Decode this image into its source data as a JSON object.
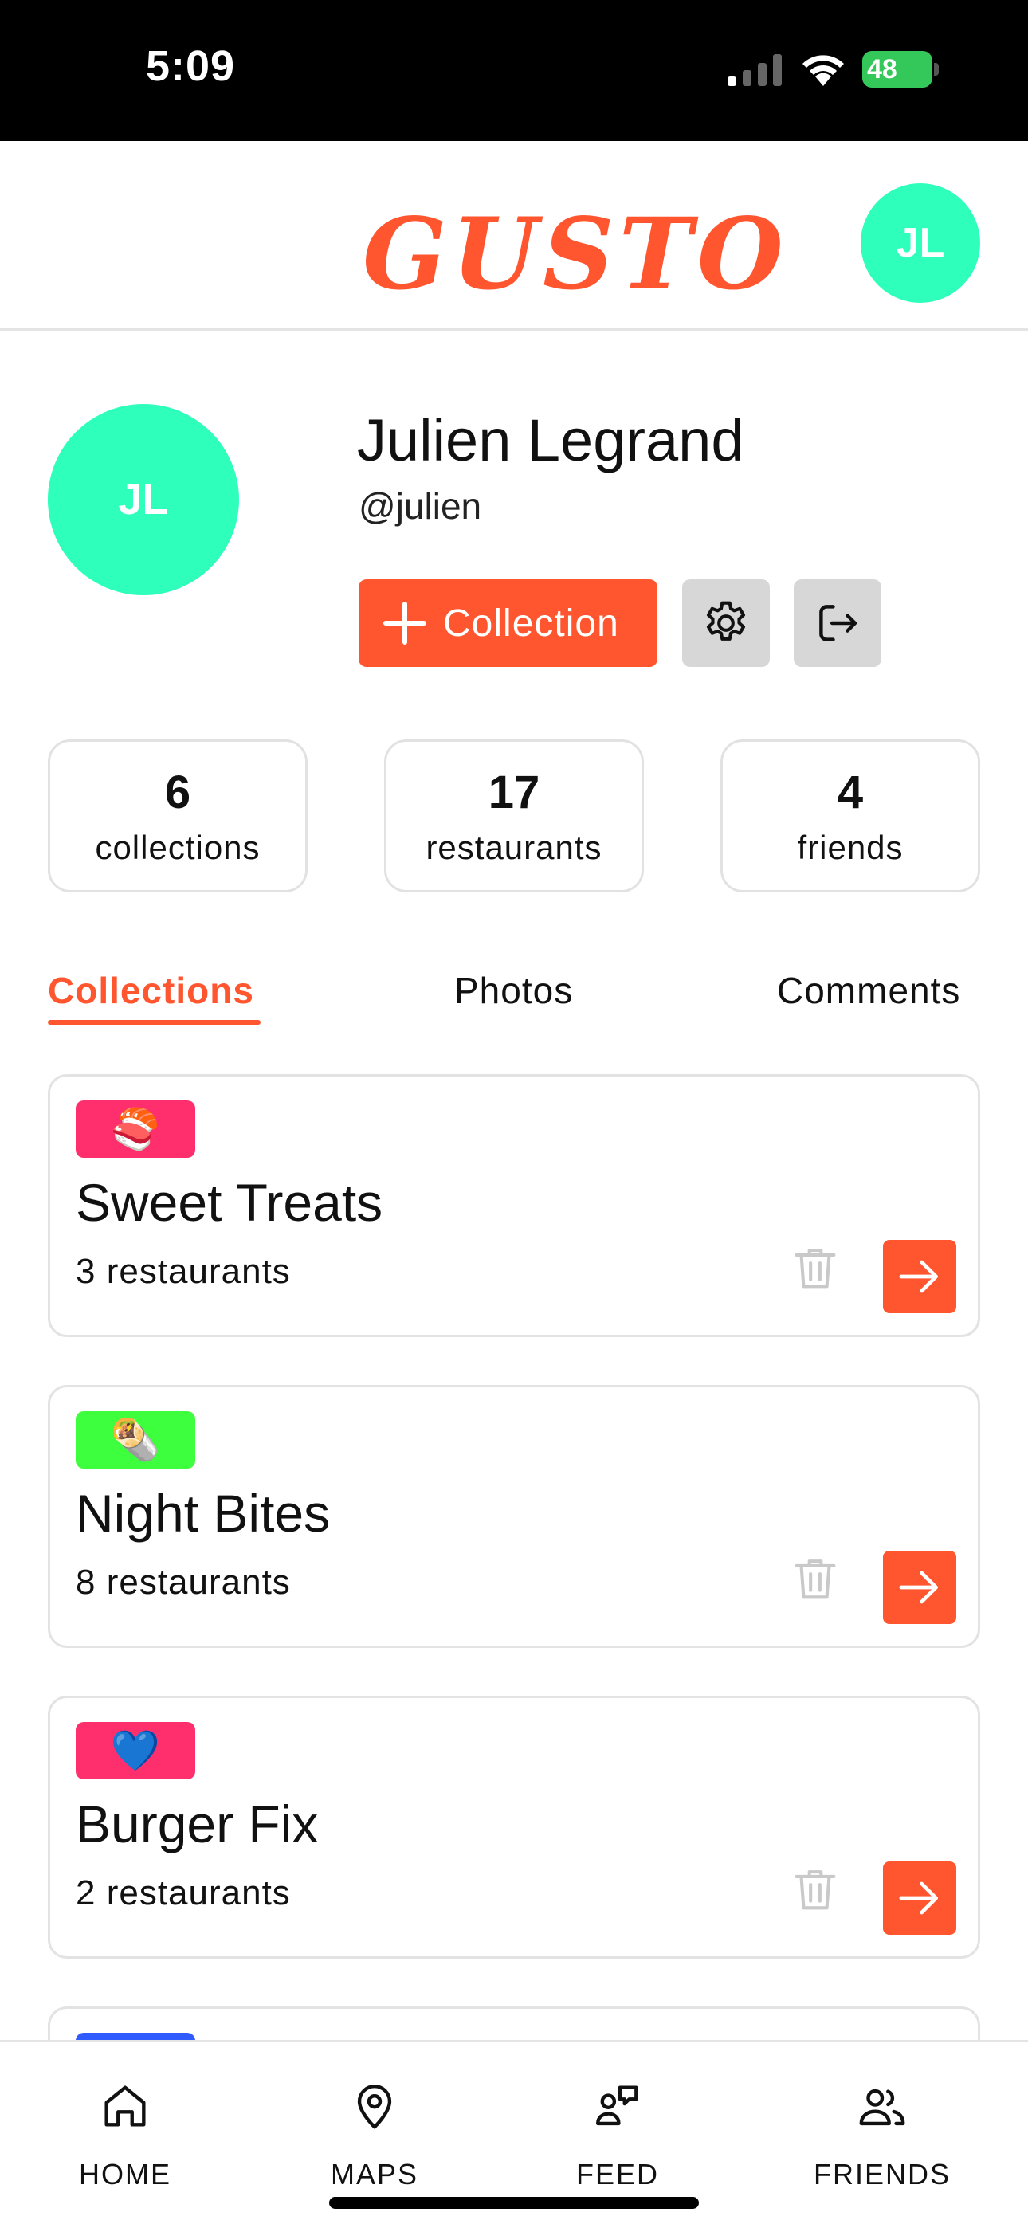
{
  "status_bar": {
    "time": "5:09",
    "battery_percent": "48"
  },
  "header": {
    "logo_text": "GUSTO",
    "avatar_initials": "JL"
  },
  "profile": {
    "avatar_initials": "JL",
    "name": "Julien Legrand",
    "handle": "@julien",
    "add_collection_label": "Collection"
  },
  "stats": [
    {
      "value": "6",
      "label": "collections"
    },
    {
      "value": "17",
      "label": "restaurants"
    },
    {
      "value": "4",
      "label": "friends"
    }
  ],
  "tabs": [
    {
      "label": "Collections",
      "active": true
    },
    {
      "label": "Photos",
      "active": false
    },
    {
      "label": "Comments",
      "active": false
    }
  ],
  "collections": [
    {
      "emoji": "🍣",
      "badge_color": "#ff2f6e",
      "title": "Sweet Treats",
      "count": "3 restaurants"
    },
    {
      "emoji": "🌯",
      "badge_color": "#3dff3d",
      "title": "Night Bites",
      "count": "8 restaurants"
    },
    {
      "emoji": "💙",
      "badge_color": "#ff2f6e",
      "title": "Burger Fix",
      "count": "2 restaurants"
    },
    {
      "emoji": "",
      "badge_color": "#2f5bff",
      "title": "",
      "count": ""
    }
  ],
  "nav": [
    {
      "label": "HOME",
      "icon": "home-icon"
    },
    {
      "label": "MAPS",
      "icon": "map-pin-icon"
    },
    {
      "label": "FEED",
      "icon": "feed-icon"
    },
    {
      "label": "FRIENDS",
      "icon": "friends-icon"
    }
  ],
  "colors": {
    "accent": "#ff5630",
    "avatar": "#2effbb",
    "button_gray": "#d7d7d7"
  }
}
